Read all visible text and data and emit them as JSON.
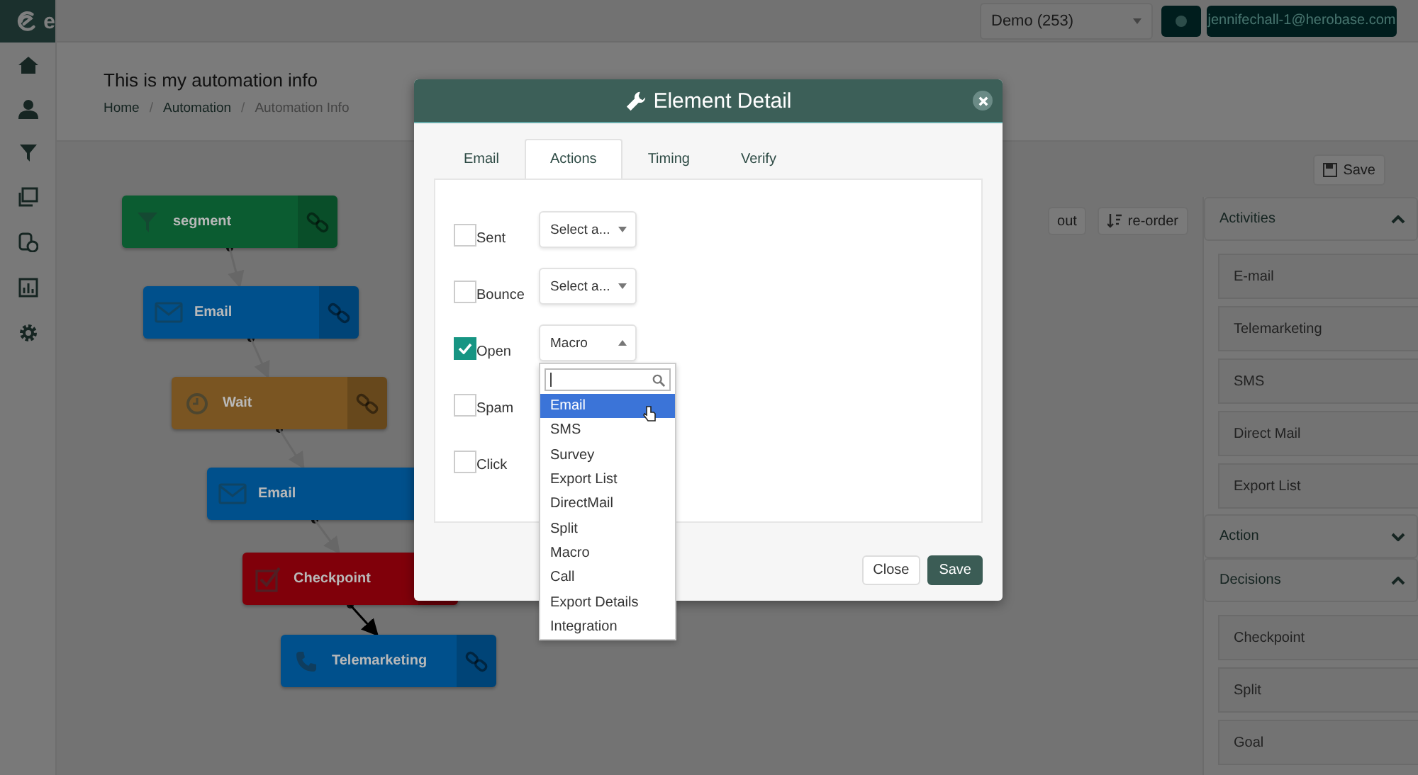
{
  "brand": {
    "logo_text": "e"
  },
  "account_select": {
    "value": "Demo (253)"
  },
  "user_button": {
    "label": "jennifechall-1@herobase.com"
  },
  "page": {
    "title": "This is my automation info",
    "breadcrumb_separator": "/",
    "breadcrumb": [
      {
        "label": "Home",
        "current": false
      },
      {
        "label": "Automation",
        "current": false
      },
      {
        "label": "Automation Info",
        "current": true
      }
    ]
  },
  "toolbar": {
    "buttons": [
      {
        "kind": "plain",
        "label": "out"
      },
      {
        "kind": "reorder",
        "label": "re-order"
      }
    ]
  },
  "save_button": {
    "label": "Save"
  },
  "flow": {
    "nodes": [
      {
        "kind": "segment",
        "label": "segment",
        "color": "#0b5c31",
        "link_button": true
      },
      {
        "kind": "email",
        "label": "Email",
        "color": "#00508c",
        "link_button": true
      },
      {
        "kind": "wait",
        "label": "Wait",
        "color": "#7a5522",
        "link_button": true
      },
      {
        "kind": "email",
        "label": "Email",
        "color": "#00508c",
        "link_button": false
      },
      {
        "kind": "checkpoint",
        "label": "Checkpoint",
        "color": "#80000a",
        "link_button": true
      },
      {
        "kind": "phone",
        "label": "Telemarketing",
        "color": "#00508c",
        "link_button": true
      }
    ],
    "edges": [
      {
        "highlighted": false
      },
      {
        "highlighted": false
      },
      {
        "highlighted": false
      },
      {
        "highlighted": false
      },
      {
        "highlighted": true
      }
    ]
  },
  "palette": {
    "sections": [
      {
        "title": "Activities",
        "expanded": true,
        "items": [
          "E-mail",
          "Telemarketing",
          "SMS",
          "Direct Mail",
          "Export List"
        ]
      },
      {
        "title": "Action",
        "expanded": false
      },
      {
        "title": "Decisions",
        "expanded": true,
        "items": [
          "Checkpoint",
          "Split",
          "Goal"
        ]
      }
    ]
  },
  "dialog": {
    "title": "Element Detail",
    "tabs": [
      {
        "label": "Email",
        "selected": false
      },
      {
        "label": "Actions",
        "selected": true
      },
      {
        "label": "Timing",
        "selected": false
      },
      {
        "label": "Verify",
        "selected": false
      }
    ],
    "actions": [
      {
        "label": "Sent",
        "checked": false,
        "select": {
          "value": "Select a...",
          "open": false
        }
      },
      {
        "label": "Bounce",
        "checked": false,
        "select": {
          "value": "Select a...",
          "open": false
        }
      },
      {
        "label": "Open",
        "checked": true,
        "select": {
          "value": "Macro",
          "open": true
        }
      },
      {
        "label": "Spam",
        "checked": false
      },
      {
        "label": "Click",
        "checked": false
      }
    ],
    "dropdown": {
      "items": [
        {
          "label": "Email",
          "selected": true
        },
        {
          "label": "SMS",
          "selected": false
        },
        {
          "label": "Survey",
          "selected": false
        },
        {
          "label": "Export List",
          "selected": false
        },
        {
          "label": "DirectMail",
          "selected": false
        },
        {
          "label": "Split",
          "selected": false
        },
        {
          "label": "Macro",
          "selected": false
        },
        {
          "label": "Call",
          "selected": false
        },
        {
          "label": "Export Details",
          "selected": false
        },
        {
          "label": "Integration",
          "selected": false
        }
      ]
    },
    "buttons": [
      {
        "kind": "secondary",
        "label": "Close"
      },
      {
        "kind": "primary",
        "label": "Save"
      }
    ]
  }
}
